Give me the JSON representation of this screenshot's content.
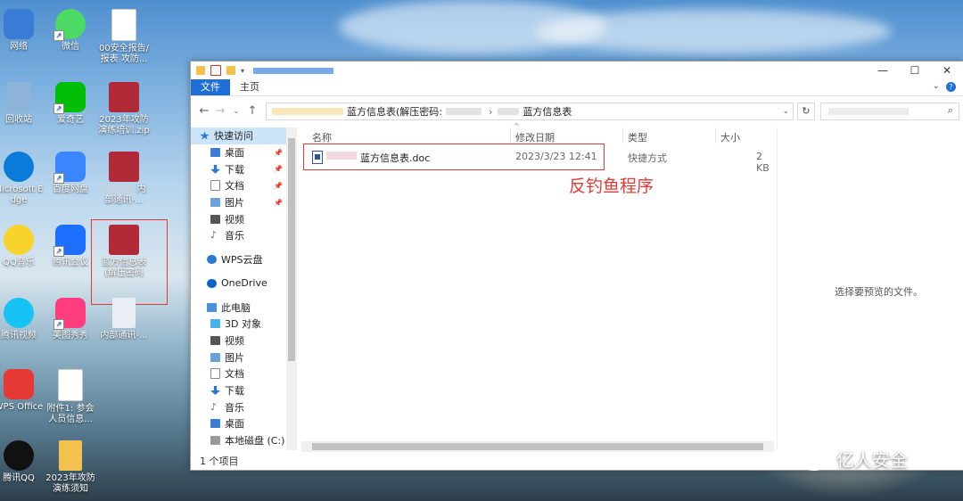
{
  "desktop": {
    "icons": [
      {
        "label": "网络",
        "color": "#3a7bd5"
      },
      {
        "label": "微信",
        "color": "#4cd964"
      },
      {
        "label": "00安全报告/报表 攻防...",
        "color": "#ffffff"
      },
      {
        "label": "回收站",
        "color": "#8fb4d9"
      },
      {
        "label": "爱奇艺",
        "color": "#00be06"
      },
      {
        "label": "2023年攻防演练培训.zip",
        "color": "#b02a37"
      },
      {
        "label": "Microsoft Edge",
        "color": "#0a7bd8"
      },
      {
        "label": "百度网盘",
        "color": "#3a86ff"
      },
      {
        "label": "内部通讯-...",
        "color": "#b02a37"
      },
      {
        "label": "QQ音乐",
        "color": "#f7d32c"
      },
      {
        "label": "腾讯会议",
        "color": "#1e6fff"
      },
      {
        "label": "蓝方信息表(解压密码",
        "color": "#b02a37"
      },
      {
        "label": "腾讯视频",
        "color": "#17c3f5"
      },
      {
        "label": "美图秀秀",
        "color": "#ff3d7f"
      },
      {
        "label": "内部通讯-...",
        "color": "#e9eef5"
      },
      {
        "label": "WPS Office",
        "color": "#e53935"
      },
      {
        "label": "附件1: 参会人员信息...",
        "color": "#ffffff"
      },
      {
        "label": "腾讯QQ",
        "color": "#111111"
      },
      {
        "label": "2023年攻防演练须知",
        "color": "#f2c14e"
      }
    ]
  },
  "window": {
    "tabs": {
      "file": "文件",
      "home": "主页"
    },
    "controls": {
      "minimize": "—",
      "maximize": "☐",
      "close": "✕"
    },
    "address": {
      "path_tail": "蓝方信息表(解压密码:",
      "current": "蓝方信息表"
    },
    "sidebar": {
      "quick_access": "快速访问",
      "items": [
        "桌面",
        "下载",
        "文档",
        "图片",
        "视频",
        "音乐"
      ],
      "wps": "WPS云盘",
      "onedrive": "OneDrive",
      "this_pc": "此电脑",
      "pc_items": [
        "3D 对象",
        "视频",
        "图片",
        "文档",
        "下载",
        "音乐",
        "桌面",
        "本地磁盘 (C:)"
      ]
    },
    "columns": {
      "name": "名称",
      "modified": "修改日期",
      "type": "类型",
      "size": "大小"
    },
    "files": [
      {
        "name": "蓝方信息表.doc",
        "modified": "2023/3/23 12:41",
        "type": "快捷方式",
        "size": "2 KB"
      }
    ],
    "annotation": "反钓鱼程序",
    "preview_text": "选择要预览的文件。",
    "status": "1 个项目"
  },
  "watermark": "亿人安全"
}
